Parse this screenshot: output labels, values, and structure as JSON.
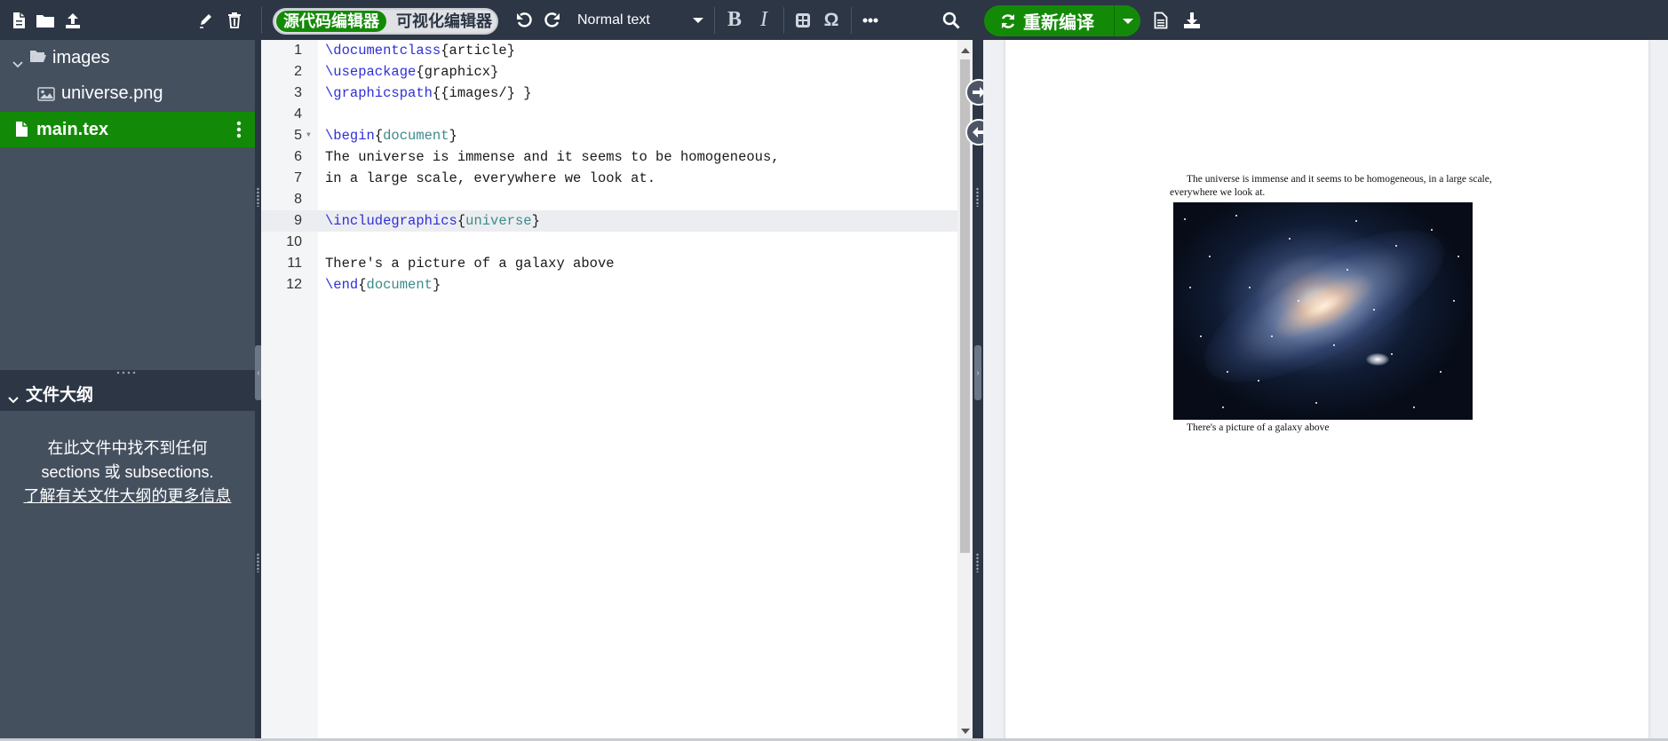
{
  "toolbar": {
    "editor_toggle": {
      "source_label": "源代码编辑器",
      "visual_label": "可视化编辑器"
    },
    "text_format": "Normal text",
    "bold_label": "B",
    "italic_label": "I",
    "omega_label": "Ω",
    "recompile_label": "重新编译"
  },
  "file_tree": {
    "folder": {
      "name": "images",
      "children": [
        "universe.png"
      ]
    },
    "active_file": "main.tex"
  },
  "outline": {
    "title": "文件大纲",
    "empty_message": "在此文件中找不到任何 sections 或 subsections.",
    "learn_more_link": "了解有关文件大纲的更多信息"
  },
  "editor": {
    "active_line": 9,
    "lines": [
      {
        "n": "1",
        "code": "\\documentclass{article}"
      },
      {
        "n": "2",
        "code": "\\usepackage{graphicx}"
      },
      {
        "n": "3",
        "code": "\\graphicspath{{images/} }"
      },
      {
        "n": "4",
        "code": ""
      },
      {
        "n": "5",
        "code": "\\begin{document}"
      },
      {
        "n": "6",
        "code": "The universe is immense and it seems to be homogeneous,"
      },
      {
        "n": "7",
        "code": "in a large scale, everywhere we look at."
      },
      {
        "n": "8",
        "code": ""
      },
      {
        "n": "9",
        "code": "\\includegraphics{universe}"
      },
      {
        "n": "10",
        "code": ""
      },
      {
        "n": "11",
        "code": "There's a picture of a galaxy above"
      },
      {
        "n": "12",
        "code": "\\end{document}"
      }
    ]
  },
  "preview": {
    "paragraph_line1": "The universe is immense and it seems to be homogeneous, in a large scale,",
    "paragraph_line2": "everywhere we look at.",
    "caption": "There's a picture of a galaxy above"
  },
  "colors": {
    "accent_green": "#138a07",
    "toolbar_bg": "#2c3645",
    "sidebar_bg": "#45505f",
    "latex_command": "#2f2fd8",
    "latex_argument": "#3d8b8b"
  },
  "icons": [
    "new-file-icon",
    "new-folder-icon",
    "upload-icon",
    "rename-icon",
    "delete-icon",
    "undo-icon",
    "redo-icon",
    "bold-icon",
    "italic-icon",
    "symbol-palette-icon",
    "omega-icon",
    "more-icon",
    "search-icon",
    "refresh-icon",
    "file-text-icon",
    "download-icon",
    "folder-open-icon",
    "image-file-icon",
    "file-icon",
    "chevron-down-icon",
    "kebab-menu-icon",
    "arrow-right-icon",
    "arrow-left-icon"
  ]
}
